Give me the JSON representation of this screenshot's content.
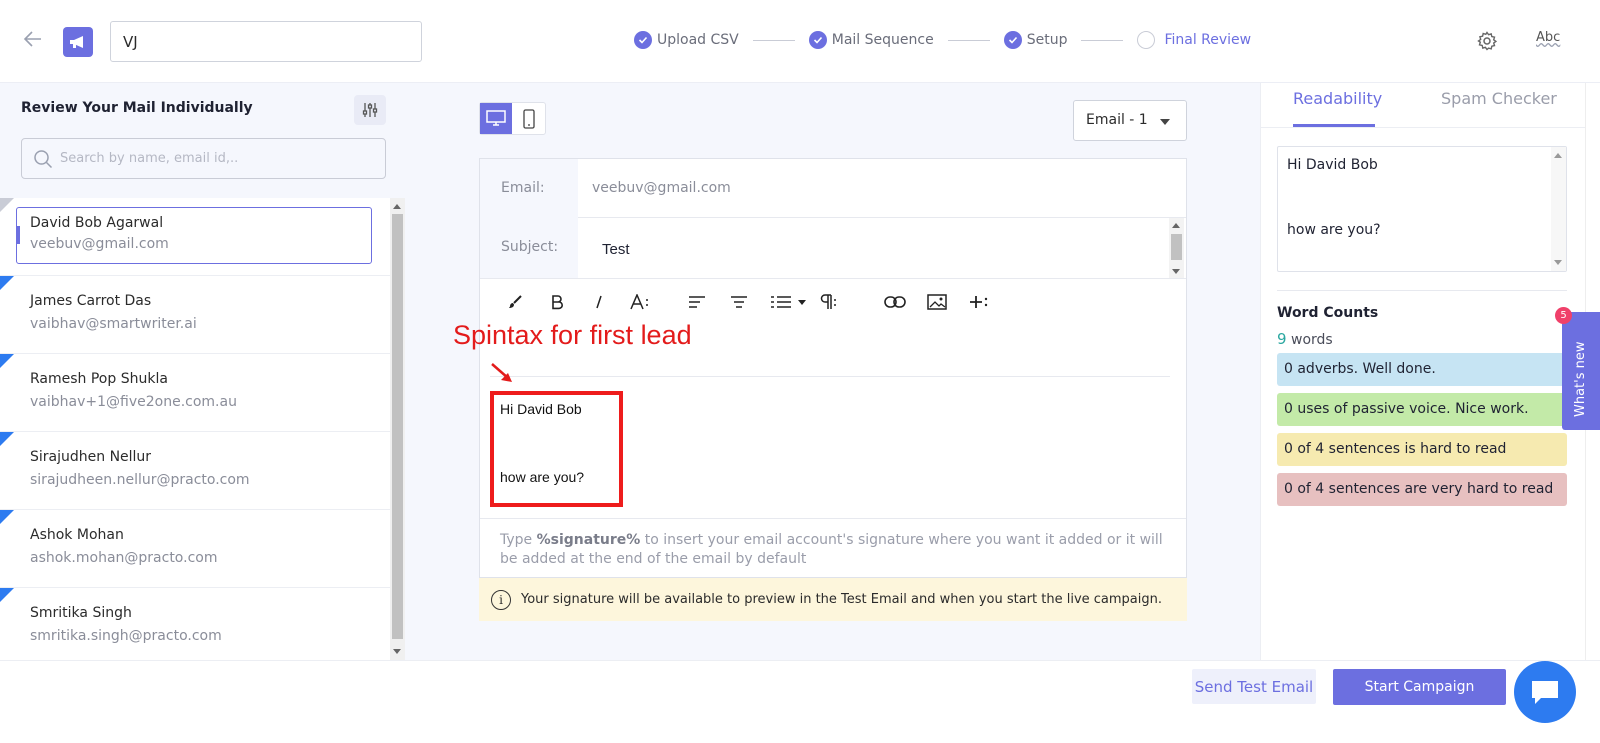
{
  "header": {
    "campaign_name": "VJ",
    "steps": [
      {
        "label": "Upload CSV",
        "done": true
      },
      {
        "label": "Mail Sequence",
        "done": true
      },
      {
        "label": "Setup",
        "done": true
      },
      {
        "label": "Final Review",
        "done": false
      }
    ],
    "abc_label": "Abc"
  },
  "left": {
    "title": "Review Your Mail Individually",
    "search_placeholder": "Search by name, email id,..",
    "leads": [
      {
        "name": "David Bob Agarwal",
        "email": "veebuv@gmail.com"
      },
      {
        "name": "James Carrot Das",
        "email": "vaibhav@smartwriter.ai"
      },
      {
        "name": "Ramesh Pop Shukla",
        "email": "vaibhav+1@five2one.com.au"
      },
      {
        "name": "Sirajudhen Nellur",
        "email": "sirajudheen.nellur@practo.com"
      },
      {
        "name": "Ashok Mohan",
        "email": "ashok.mohan@practo.com"
      },
      {
        "name": "Smritika Singh",
        "email": "smritika.singh@practo.com"
      }
    ]
  },
  "center": {
    "email_select": "Email - 1",
    "email_label": "Email:",
    "email_value": "veebuv@gmail.com",
    "subject_label": "Subject:",
    "subject_value": "Test",
    "annotation": "Spintax for first lead",
    "body_line1": "Hi David Bob",
    "body_line2": "how are you?",
    "signature_hint_pre": "Type ",
    "signature_hint_token": "%signature%",
    "signature_hint_post": " to insert your email account's signature where you want it added or it will be added at the end of the email by default",
    "notice": "Your signature will be available to preview in the Test Email and when you start the live campaign."
  },
  "right": {
    "tab_readability": "Readability",
    "tab_spam": "Spam Checker",
    "preview_line1": "Hi David Bob",
    "preview_line2": "how are you?",
    "word_counts_title": "Word Counts",
    "word_count": "9",
    "words_label": "words",
    "pills": [
      "0 adverbs. Well done.",
      "0 uses of passive voice. Nice work.",
      "0 of 4 sentences is hard to read",
      "0 of 4 sentences are very hard to read"
    ],
    "whats_new": "What's new",
    "whats_new_badge": "5"
  },
  "footer": {
    "send_test": "Send Test Email",
    "start_campaign": "Start Campaign"
  },
  "colors": {
    "accent": "#6c6fe0",
    "annotation_red": "#ee1c1c",
    "lead_marker": "#2d7bf0"
  }
}
